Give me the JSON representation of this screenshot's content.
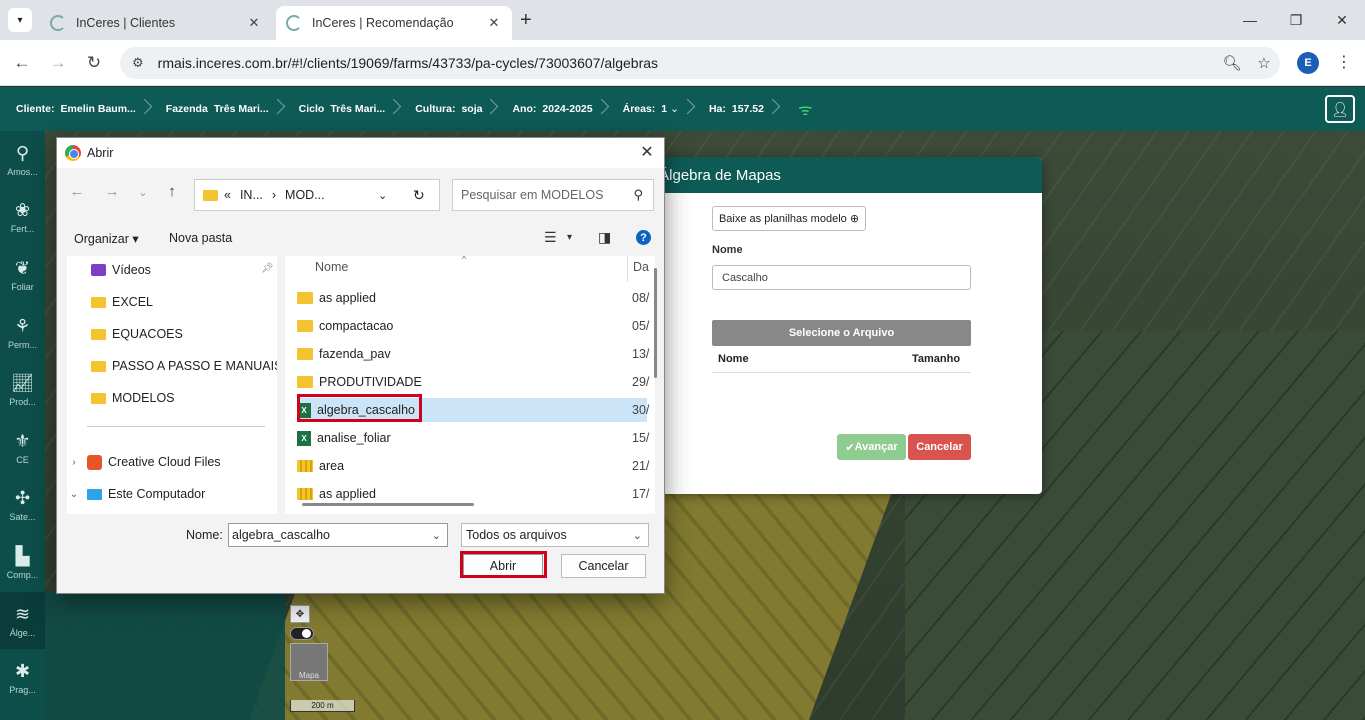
{
  "browser": {
    "tabs": [
      {
        "title": "InCeres | Clientes",
        "active": false
      },
      {
        "title": "InCeres | Recomendação",
        "active": true
      }
    ],
    "url": "rmais.inceres.com.br/#!/clients/19069/farms/43733/pa-cycles/73003607/algebras",
    "profile_initial": "E",
    "icons": {
      "back": "arrow-left-icon",
      "forward": "arrow-right-icon",
      "reload": "reload-icon",
      "zoom": "zoom-icon",
      "bookmark": "star-icon",
      "menu": "kebab-icon"
    }
  },
  "header": {
    "crumbs": [
      {
        "key": "Cliente:",
        "value": "Emelin Baum..."
      },
      {
        "key": "Fazenda",
        "value": "Três Mari..."
      },
      {
        "key": "Ciclo",
        "value": "Três Mari..."
      },
      {
        "key": "Cultura:",
        "value": "soja"
      },
      {
        "key": "Ano:",
        "value": "2024-2025"
      },
      {
        "key": "Áreas:",
        "value": "1"
      },
      {
        "key": "Ha:",
        "value": "157.52"
      }
    ],
    "accent": "#0e5a56"
  },
  "sidebar": {
    "items": [
      {
        "label": "Amos...",
        "icon": "sampling-icon"
      },
      {
        "label": "Fert...",
        "icon": "fertilizer-icon"
      },
      {
        "label": "Foliar",
        "icon": "leaf-icon"
      },
      {
        "label": "Perm...",
        "icon": "plant-icon"
      },
      {
        "label": "Prod...",
        "icon": "chart-icon"
      },
      {
        "label": "CE",
        "icon": "sprout-icon"
      },
      {
        "label": "Sate...",
        "icon": "satellite-icon"
      },
      {
        "label": "Comp...",
        "icon": "tractor-icon"
      },
      {
        "label": "Álge...",
        "icon": "layers-icon"
      },
      {
        "label": "Prag...",
        "icon": "bug-icon"
      }
    ]
  },
  "map": {
    "scale_label": "200 m",
    "thumb_label": "Mapa"
  },
  "algebra_modal": {
    "title": "r Álgebra de Mapas",
    "download_label": "Baixe as planilhas modelo",
    "name_label": "Nome",
    "name_value": "Cascalho",
    "select_file_label": "Selecione o Arquivo",
    "col_name": "Nome",
    "col_size": "Tamanho",
    "next_label": "Avançar",
    "cancel_label": "Cancelar"
  },
  "dialog": {
    "title": "Abrir",
    "path": {
      "prefix": "«",
      "parts": [
        "IN...",
        "MOD..."
      ]
    },
    "search_placeholder": "Pesquisar em MODELOS",
    "organize_label": "Organizar",
    "new_folder_label": "Nova pasta",
    "nav_items": [
      {
        "label": "Vídeos",
        "type": "video"
      },
      {
        "label": "EXCEL",
        "type": "folder"
      },
      {
        "label": "EQUACOES",
        "type": "folder"
      },
      {
        "label": "PASSO A PASSO E MANUAIS",
        "type": "folder"
      },
      {
        "label": "MODELOS",
        "type": "folder"
      },
      {
        "label": "Creative Cloud Files",
        "type": "cloud"
      },
      {
        "label": "Este Computador",
        "type": "pc"
      }
    ],
    "col_name": "Nome",
    "col_date": "Da",
    "files": [
      {
        "name": "as applied",
        "date": "08/",
        "type": "folder"
      },
      {
        "name": "compactacao",
        "date": "05/",
        "type": "folder"
      },
      {
        "name": "fazenda_pav",
        "date": "13/",
        "type": "folder"
      },
      {
        "name": "PRODUTIVIDADE",
        "date": "29/",
        "type": "folder"
      },
      {
        "name": "algebra_cascalho",
        "date": "30/",
        "type": "excel"
      },
      {
        "name": "analise_foliar",
        "date": "15/",
        "type": "excel"
      },
      {
        "name": "area",
        "date": "21/",
        "type": "zip"
      },
      {
        "name": "as applied",
        "date": "17/",
        "type": "zip"
      }
    ],
    "filename_label": "Nome:",
    "filename_value": "algebra_cascalho",
    "filetype_value": "Todos os arquivos",
    "open_label": "Abrir",
    "cancel_label": "Cancelar"
  }
}
